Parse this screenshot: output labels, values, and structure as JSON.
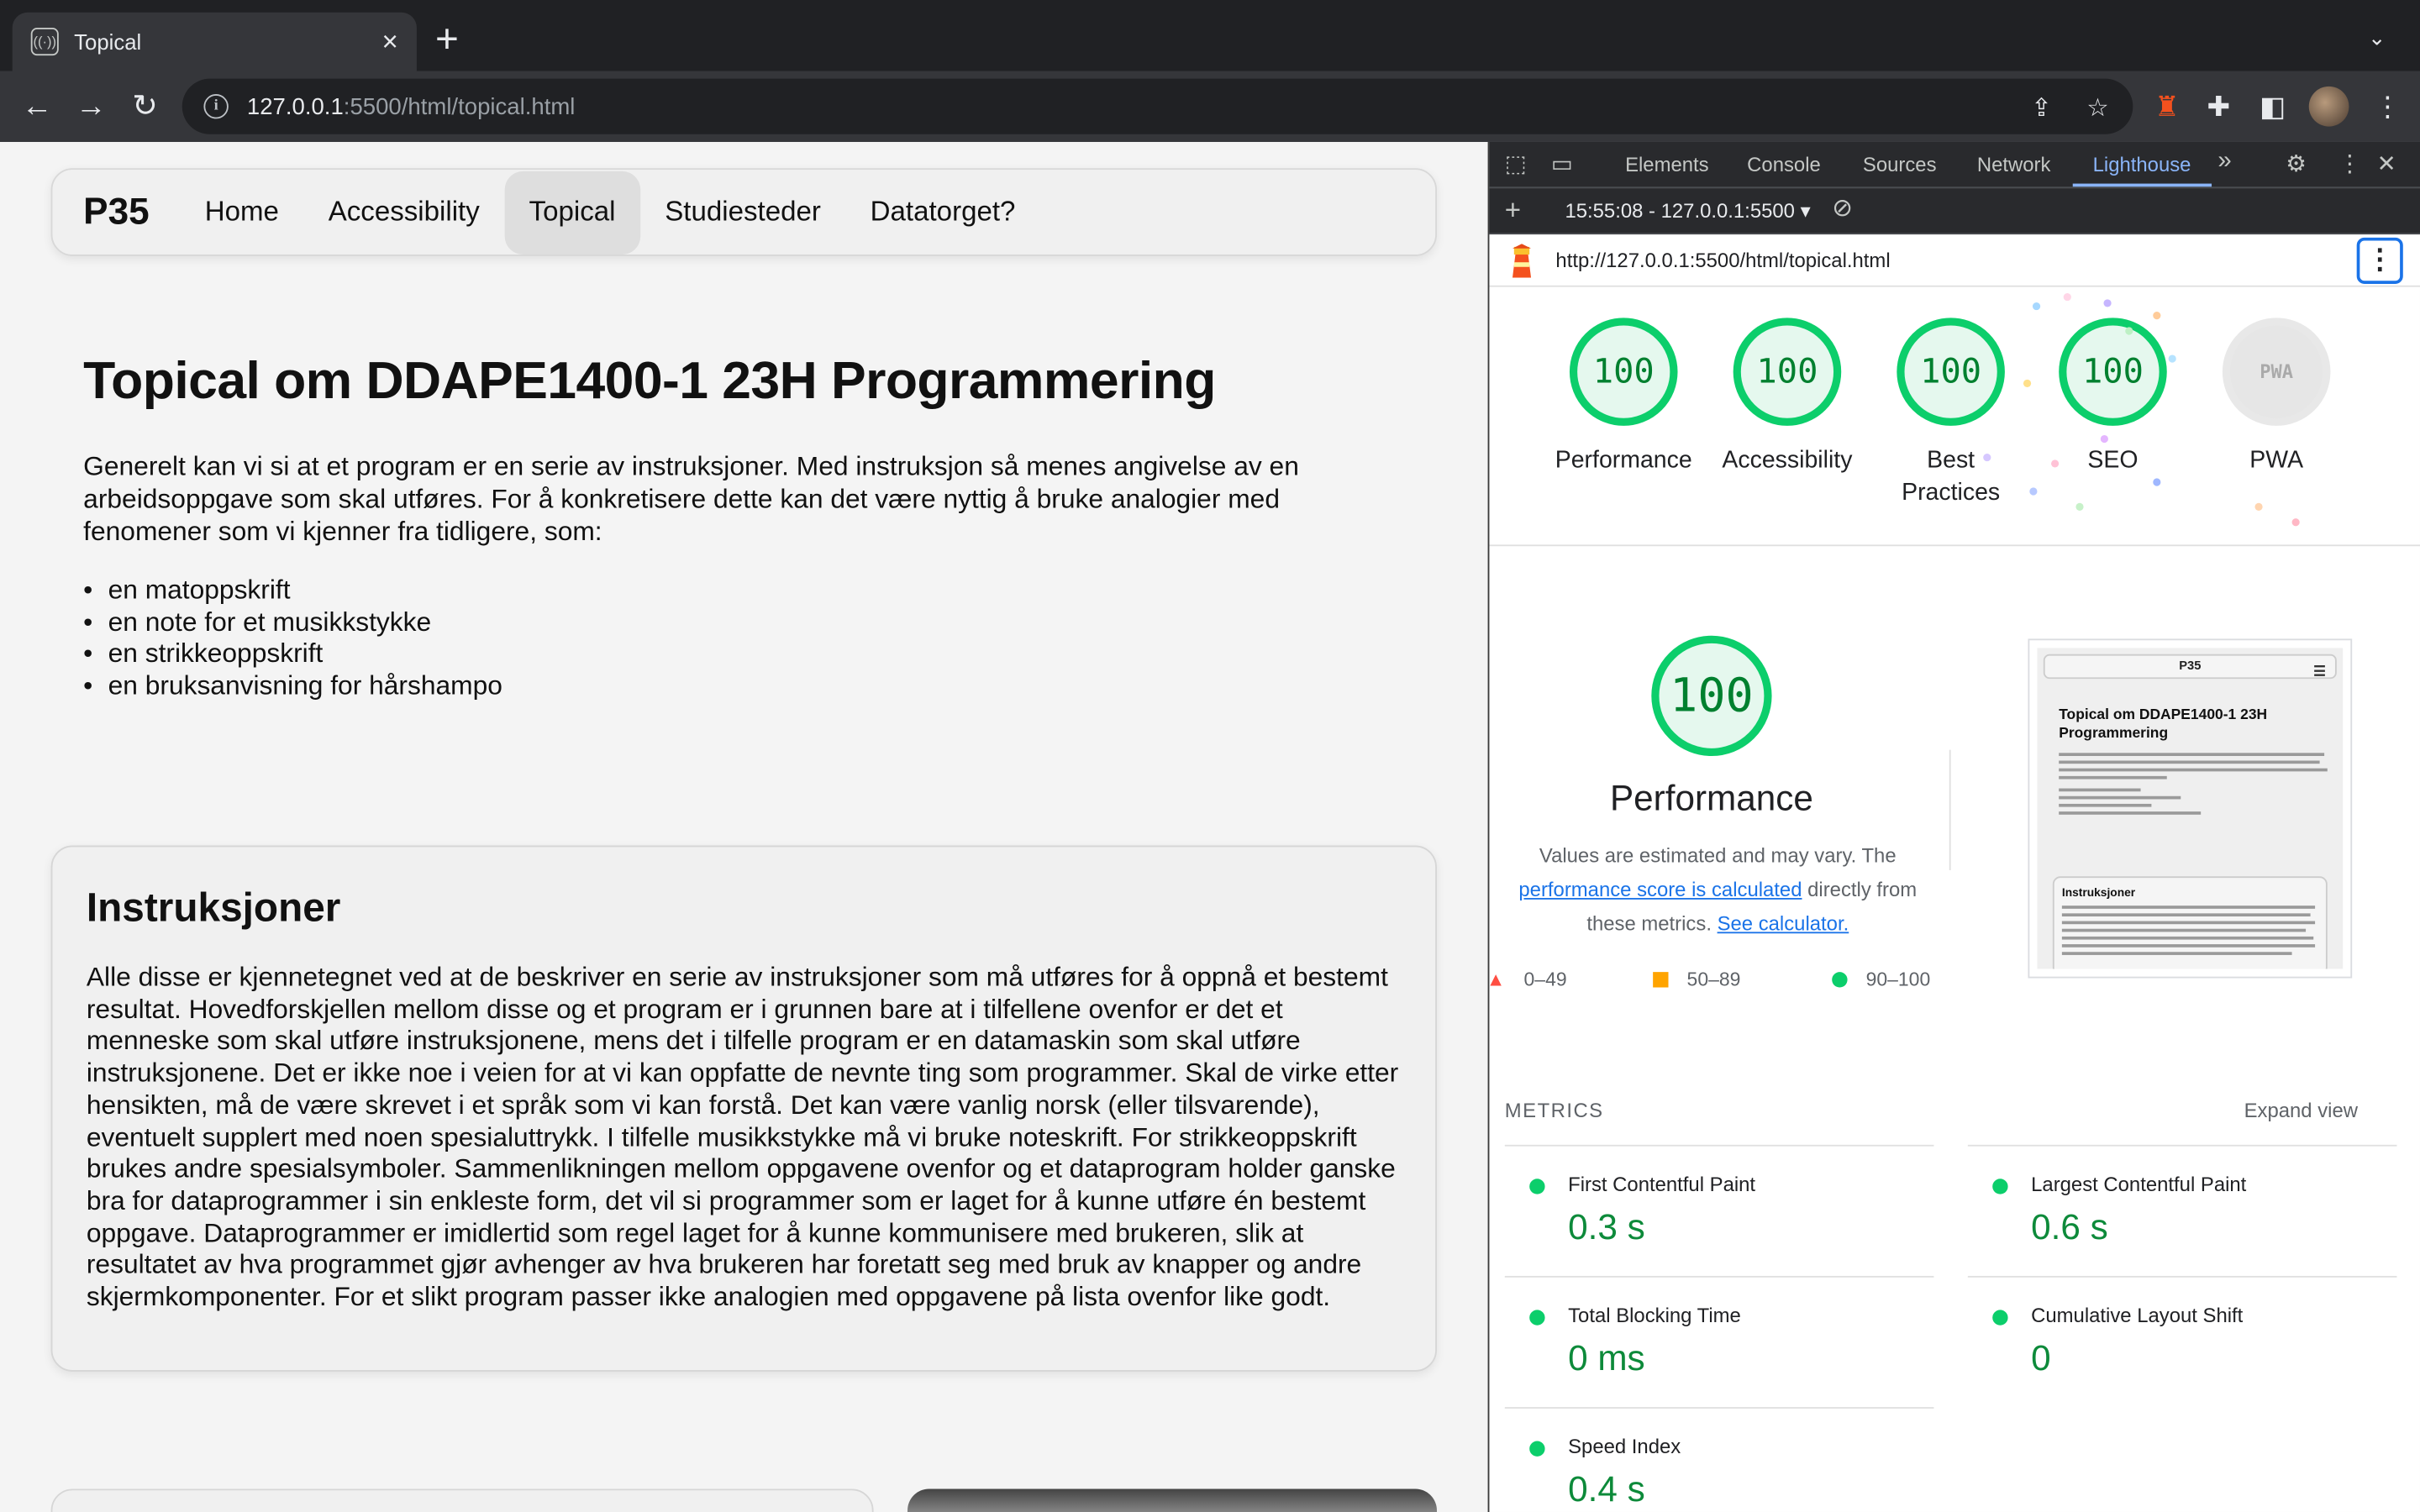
{
  "browser": {
    "tab_title": "Topical",
    "tab_close": "×",
    "new_tab": "+",
    "tab_search": "⌄",
    "url_host": "127.0.0.1",
    "url_rest": ":5500/html/topical.html",
    "icons": [
      "back-arrow-icon",
      "forward-arrow-icon",
      "reload-icon",
      "info-icon",
      "share-icon",
      "star-icon",
      "lighthouse-icon",
      "puzzle-icon",
      "side-panel-icon",
      "avatar",
      "kebab-icon"
    ]
  },
  "site": {
    "logo": "P35",
    "nav": [
      {
        "label": "Home",
        "active": false
      },
      {
        "label": "Accessibility",
        "active": false
      },
      {
        "label": "Topical",
        "active": true
      },
      {
        "label": "Studiesteder",
        "active": false
      },
      {
        "label": "Datatorget?",
        "active": false
      }
    ],
    "title": "Topical om DDAPE1400-1 23H Programmering",
    "intro": "Generelt kan vi si at et program er en serie av instruksjoner. Med instruksjon så menes angivelse av en arbeidsoppgave som skal utføres. For å konkretisere dette kan det være nyttig å bruke analogier med fenomener som vi kjenner fra tidligere, som:",
    "bullets": [
      "en matoppskrift",
      "en note for et musikkstykke",
      "en strikkeoppskrift",
      "en bruksanvisning for hårshampo"
    ],
    "card_title": "Instruksjoner",
    "card_text": "Alle disse er kjennetegnet ved at de beskriver en serie av instruksjoner som må utføres for å oppnå et bestemt resultat. Hovedforskjellen mellom disse og et program er i grunnen bare at i tilfellene ovenfor er det et menneske som skal utføre instruksjonene, mens det i tilfelle program er en datamaskin som skal utføre instruksjonene. Det er ikke noe i veien for at vi kan oppfatte de nevnte ting som programmer. Skal de virke etter hensikten, må de være skrevet i et språk som vi kan forstå. Det kan være vanlig norsk (eller tilsvarende), eventuelt supplert med noen spesialuttrykk. I tilfelle musikkstykke må vi bruke noteskrift. For strikkeoppskrift brukes andre spesialsymboler. Sammenlikningen mellom oppgavene ovenfor og et dataprogram holder ganske bra for dataprogrammer i sin enkleste form, det vil si programmer som er laget for å kunne utføre én bestemt oppgave. Dataprogrammer er imidlertid som regel laget for å kunne kommunisere med brukeren, slik at resultatet av hva programmet gjør avhenger av hva brukeren har foretatt seg med bruk av knapper og andre skjermkomponenter. For et slikt program passer ikke analogien med oppgavene på lista ovenfor like godt."
  },
  "devtools": {
    "tabs": [
      "Elements",
      "Console",
      "Sources",
      "Network",
      "Lighthouse"
    ],
    "active_tab": "Lighthouse",
    "more": "»",
    "report_select": "15:55:08 - 127.0.0.1:5500",
    "report_url": "http://127.0.0.1:5500/html/topical.html",
    "gauges": [
      {
        "score": "100",
        "label": "Performance"
      },
      {
        "score": "100",
        "label": "Accessibility"
      },
      {
        "score": "100",
        "label": "Best Practices"
      },
      {
        "score": "100",
        "label": "SEO"
      },
      {
        "score": "PWA",
        "label": "PWA"
      }
    ],
    "perf_score": "100",
    "perf_title": "Performance",
    "perf_desc_1": "Values are estimated and may vary. The ",
    "perf_link_1": "performance score is calculated",
    "perf_desc_2": " directly from these metrics. ",
    "perf_link_2": "See calculator.",
    "legend": [
      "0–49",
      "50–89",
      "90–100"
    ],
    "thumb": {
      "logo": "P35",
      "title": "Topical om DDAPE1400-1 23H Programmering",
      "card_title": "Instruksjoner"
    },
    "metrics_heading": "METRICS",
    "expand_label": "Expand view",
    "metrics": [
      {
        "name": "First Contentful Paint",
        "value": "0.3 s"
      },
      {
        "name": "Largest Contentful Paint",
        "value": "0.6 s"
      },
      {
        "name": "Total Blocking Time",
        "value": "0 ms"
      },
      {
        "name": "Cumulative Layout Shift",
        "value": "0"
      },
      {
        "name": "Speed Index",
        "value": "0.4 s"
      }
    ],
    "colors": {
      "pass": "#0cce6b",
      "average": "#ffa400",
      "fail": "#ff4e42",
      "link": "#1a73e8"
    }
  }
}
